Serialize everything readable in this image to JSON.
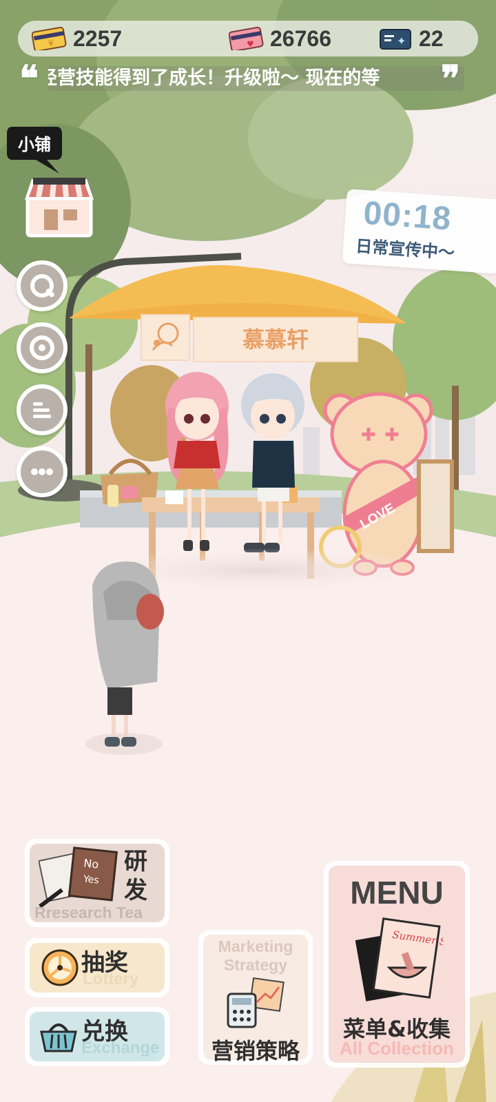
{
  "currencies": [
    {
      "name": "gold-card",
      "value": "2257",
      "color": "#f3c84b"
    },
    {
      "name": "love-card",
      "value": "26766",
      "color": "#f39aa6"
    },
    {
      "name": "ticket",
      "value": "22",
      "color": "#2e4e6d"
    }
  ],
  "marquee": {
    "text": "经营技能得到了成长！升级啦～ 现在的等"
  },
  "shop": {
    "label": "小铺"
  },
  "left_buttons": [
    {
      "icon": "wrench-icon"
    },
    {
      "icon": "camera-lens-icon"
    },
    {
      "icon": "list-icon"
    },
    {
      "icon": "more-icon"
    }
  ],
  "timer": {
    "time": "00:18",
    "status": "日常宣传中～"
  },
  "stall": {
    "name": "慕慕轩"
  },
  "buttons": {
    "research": {
      "cn": "研发",
      "en": "Rresearch Tea"
    },
    "lottery": {
      "cn": "抽奖",
      "en": "Lottery"
    },
    "exchange": {
      "cn": "兑换",
      "en": "Exchange"
    },
    "marketing": {
      "en": "Marketing Strategy",
      "cn": "营销策略"
    },
    "menu": {
      "title": "MENU",
      "cn": "菜单&收集",
      "en": "All Collection"
    }
  },
  "mascot": {
    "sash_text": "LOVE"
  },
  "menu_art": {
    "script_text": "Summer Sale"
  },
  "note": {
    "label_no": "No",
    "label_yes": "Yes"
  }
}
